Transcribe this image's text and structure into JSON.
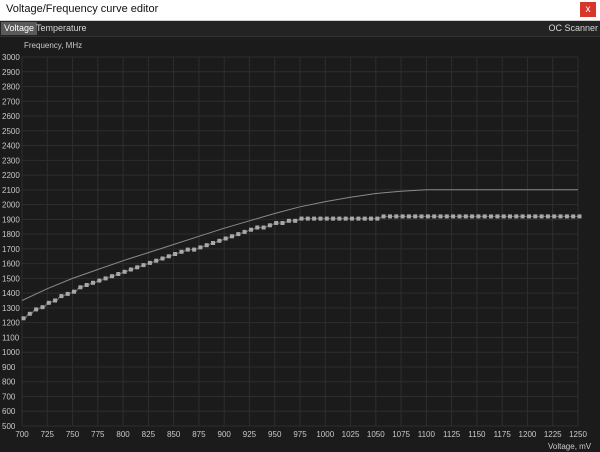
{
  "window": {
    "title": "Voltage/Frequency curve editor",
    "close_label": "x"
  },
  "tabs": [
    {
      "label": "Voltage",
      "active": true
    },
    {
      "label": "Temperature",
      "active": false
    }
  ],
  "oc_scanner_label": "OC Scanner",
  "colors": {
    "background": "#1b1b1b",
    "grid": "#2e2e2e",
    "curve": "#8a8a8a",
    "points": "#a8a8a8",
    "close": "#d9362b"
  },
  "chart_data": {
    "type": "line",
    "ylabel": "Frequency, MHz",
    "xlabel": "Voltage, mV",
    "xlim": [
      700,
      1250
    ],
    "ylim": [
      500,
      3000
    ],
    "grid": true,
    "x_ticks": [
      700,
      725,
      750,
      775,
      800,
      825,
      850,
      875,
      900,
      925,
      950,
      975,
      1000,
      1025,
      1050,
      1075,
      1100,
      1125,
      1150,
      1175,
      1200,
      1225,
      1250
    ],
    "y_ticks": [
      500,
      600,
      700,
      800,
      900,
      1000,
      1100,
      1200,
      1300,
      1400,
      1500,
      1600,
      1700,
      1800,
      1900,
      2000,
      2100,
      2200,
      2300,
      2400,
      2500,
      2600,
      2700,
      2800,
      2900,
      3000
    ],
    "series": [
      {
        "style": "thin-line",
        "x": [
          700,
          725,
          750,
          775,
          800,
          825,
          850,
          875,
          900,
          925,
          950,
          975,
          1000,
          1025,
          1050,
          1075,
          1100,
          1125,
          1150,
          1175,
          1200,
          1225,
          1250
        ],
        "y": [
          1350,
          1430,
          1500,
          1560,
          1620,
          1675,
          1730,
          1785,
          1840,
          1890,
          1940,
          1985,
          2020,
          2050,
          2075,
          2090,
          2100,
          2100,
          2100,
          2100,
          2100,
          2100,
          2100
        ]
      },
      {
        "style": "point-steps",
        "x": [
          700,
          725,
          750,
          775,
          800,
          825,
          850,
          875,
          900,
          925,
          950,
          975,
          1000,
          1025,
          1050,
          1075,
          1100,
          1125,
          1150,
          1175,
          1200,
          1225,
          1250
        ],
        "y": [
          1235,
          1330,
          1415,
          1490,
          1550,
          1605,
          1660,
          1715,
          1775,
          1830,
          1870,
          1900,
          1905,
          1908,
          1912,
          1915,
          1918,
          1920,
          1920,
          1920,
          1920,
          1920,
          1920
        ]
      }
    ]
  }
}
